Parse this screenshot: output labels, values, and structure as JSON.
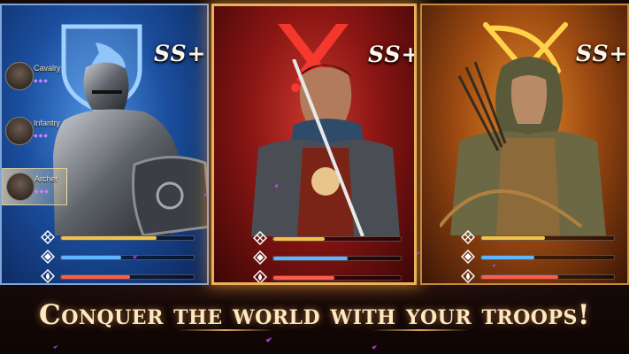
{
  "cards": [
    {
      "name": "cavalry-card",
      "grade": "SS+",
      "emblem": "horse-shield-emblem",
      "stats": [
        {
          "icon": "attack-stat-icon",
          "value": 0.72,
          "color": "#f0c24a"
        },
        {
          "icon": "defense-stat-icon",
          "value": 0.45,
          "color": "#5fb6ff"
        },
        {
          "icon": "hp-stat-icon",
          "value": 0.52,
          "color": "#ff5a4a"
        }
      ]
    },
    {
      "name": "infantry-card",
      "grade": "SS+",
      "emblem": "crossed-swords-emblem",
      "stats": [
        {
          "icon": "attack-stat-icon",
          "value": 0.4,
          "color": "#f0c24a"
        },
        {
          "icon": "defense-stat-icon",
          "value": 0.58,
          "color": "#5fb6ff"
        },
        {
          "icon": "hp-stat-icon",
          "value": 0.48,
          "color": "#ff5a4a"
        }
      ]
    },
    {
      "name": "archer-card",
      "grade": "SS+",
      "emblem": "crossed-bow-emblem",
      "stats": [
        {
          "icon": "attack-stat-icon",
          "value": 0.48,
          "color": "#f0c24a"
        },
        {
          "icon": "defense-stat-icon",
          "value": 0.4,
          "color": "#5fb6ff"
        },
        {
          "icon": "hp-stat-icon",
          "value": 0.58,
          "color": "#ff5a4a"
        }
      ]
    }
  ],
  "troops": [
    {
      "label": "Cavalry",
      "pips": "◆◆◆",
      "selected": false
    },
    {
      "label": "Infantry",
      "pips": "◆◆◆",
      "selected": false
    },
    {
      "label": "Archer",
      "pips": "◆◆◆",
      "selected": true
    }
  ],
  "tagline": "Conquer the world with your troops!",
  "colors": {
    "cavalry": "#1b4f9f",
    "infantry": "#8b1614",
    "archer": "#a04c12",
    "gold": "#e8b25a"
  }
}
